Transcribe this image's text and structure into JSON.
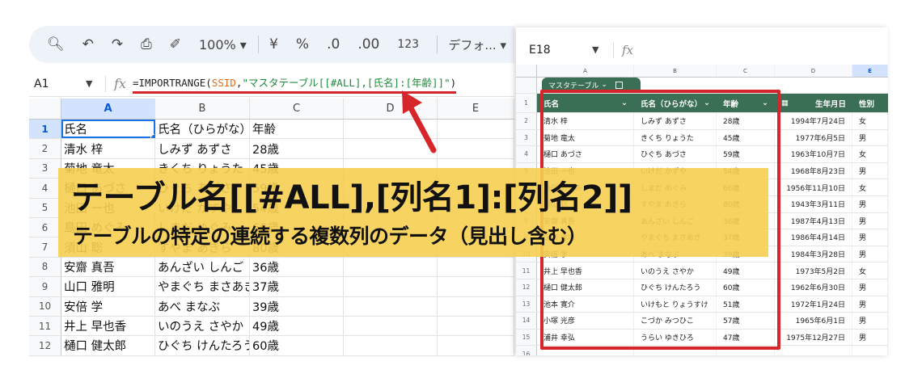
{
  "left_sheet": {
    "toolbar": {
      "search_icon": "search-icon",
      "undo_icon": "undo-icon",
      "redo_icon": "redo-icon",
      "print_icon": "print-icon",
      "paint_format_icon": "paint-format-icon",
      "zoom": "100%",
      "currency": "¥",
      "percent": "%",
      "decrease_decimal": ".0",
      "increase_decimal": ".00",
      "number_format": "123",
      "font": "デフォ..."
    },
    "formula_bar": {
      "cell_ref": "A1",
      "formula_prefix": "=IMPORTRANGE(",
      "formula_ref": "SSID",
      "formula_comma": ",",
      "formula_string": "\"マスタテーブル[[#ALL],[氏名]:[年齢]]\"",
      "formula_suffix": ")"
    },
    "columns": [
      "A",
      "B",
      "C",
      "D",
      "E"
    ],
    "rows": [
      {
        "n": "1",
        "a": "氏名",
        "b": "氏名（ひらがな）",
        "c": "年齢"
      },
      {
        "n": "2",
        "a": "清水 梓",
        "b": "しみず あずさ",
        "c": "28歳"
      },
      {
        "n": "3",
        "a": "菊地 竜太",
        "b": "きくち りょうた",
        "c": "45歳"
      },
      {
        "n": "4",
        "a": "樋口 あづさ",
        "b": "ひぐち あづさ",
        "c": "59歳"
      },
      {
        "n": "5",
        "a": "池田 一也",
        "b": "いけだ かずや",
        "c": "54歳"
      },
      {
        "n": "6",
        "a": "島田 めぐみ",
        "b": "しまだ めぐみ",
        "c": "66歳"
      },
      {
        "n": "7",
        "a": "須山 聡",
        "b": "すやま あきら",
        "c": "80歳"
      },
      {
        "n": "8",
        "a": "安齋 真吾",
        "b": "あんざい しんご",
        "c": "36歳"
      },
      {
        "n": "9",
        "a": "山口 雅明",
        "b": "やまぐち まさあき",
        "c": "37歳"
      },
      {
        "n": "10",
        "a": "安倍 学",
        "b": "あべ まなぶ",
        "c": "39歳"
      },
      {
        "n": "11",
        "a": "井上 早也香",
        "b": "いのうえ さやか",
        "c": "49歳"
      },
      {
        "n": "12",
        "a": "樋口 健太郎",
        "b": "ひぐち けんたろう",
        "c": "60歳"
      }
    ]
  },
  "right_sheet": {
    "cell_ref": "E18",
    "fx": "fx",
    "columns": [
      "A",
      "B",
      "C",
      "D",
      "E"
    ],
    "table_name": "マスタテーブル",
    "headers": [
      "氏名",
      "氏名（ひらがな）",
      "年齢",
      "生年月日",
      "性別"
    ],
    "rows": [
      {
        "n": "2",
        "name": "清水 梓",
        "kana": "しみず あずさ",
        "age": "28歳",
        "dob": "1994年7月24日",
        "sex": "女"
      },
      {
        "n": "3",
        "name": "菊地 竜太",
        "kana": "きくち りょうた",
        "age": "45歳",
        "dob": "1977年6月5日",
        "sex": "男"
      },
      {
        "n": "4",
        "name": "樋口 あづさ",
        "kana": "ひぐち あづさ",
        "age": "59歳",
        "dob": "1963年10月7日",
        "sex": "女"
      },
      {
        "n": "5",
        "name": "池田 一也",
        "kana": "いけだ かずや",
        "age": "54歳",
        "dob": "1968年8月23日",
        "sex": "男"
      },
      {
        "n": "6",
        "name": "島田 めぐみ",
        "kana": "しまだ めぐみ",
        "age": "66歳",
        "dob": "1956年11月10日",
        "sex": "女"
      },
      {
        "n": "7",
        "name": "須山 聡",
        "kana": "すやま あきら",
        "age": "80歳",
        "dob": "1943年3月11日",
        "sex": "男"
      },
      {
        "n": "8",
        "name": "安齋 真吾",
        "kana": "あんざい しんご",
        "age": "36歳",
        "dob": "1987年4月13日",
        "sex": "男"
      },
      {
        "n": "9",
        "name": "山口 雅明",
        "kana": "やまぐち まさあき",
        "age": "37歳",
        "dob": "1986年4月14日",
        "sex": "男"
      },
      {
        "n": "10",
        "name": "安倍 学",
        "kana": "あべ まなぶ",
        "age": "39歳",
        "dob": "1984年3月28日",
        "sex": "男"
      },
      {
        "n": "11",
        "name": "井上 早也香",
        "kana": "いのうえ さやか",
        "age": "49歳",
        "dob": "1973年5月2日",
        "sex": "女"
      },
      {
        "n": "12",
        "name": "樋口 健太郎",
        "kana": "ひぐち けんたろう",
        "age": "60歳",
        "dob": "1962年6月30日",
        "sex": "男"
      },
      {
        "n": "13",
        "name": "池本 寛介",
        "kana": "いけもと りょうすけ",
        "age": "51歳",
        "dob": "1972年1月24日",
        "sex": "男"
      },
      {
        "n": "14",
        "name": "小塚 光彦",
        "kana": "こづか みつひこ",
        "age": "57歳",
        "dob": "1965年6月1日",
        "sex": "男"
      },
      {
        "n": "15",
        "name": "浦井 幸弘",
        "kana": "うらい ゆきひろ",
        "age": "47歳",
        "dob": "1975年12月27日",
        "sex": "男"
      },
      {
        "n": "16",
        "name": "",
        "kana": "",
        "age": "",
        "dob": "",
        "sex": ""
      }
    ]
  },
  "banner": {
    "title": "テーブル名[[#ALL],[列名1]:[列名2]]",
    "subtitle": "テーブルの特定の連続する複数列のデータ（見出し含む）",
    "color": "#f6ce50"
  },
  "colors": {
    "highlight_red": "#d6262b",
    "table_green": "#3a6e55",
    "selection_blue": "#1a73e8"
  }
}
